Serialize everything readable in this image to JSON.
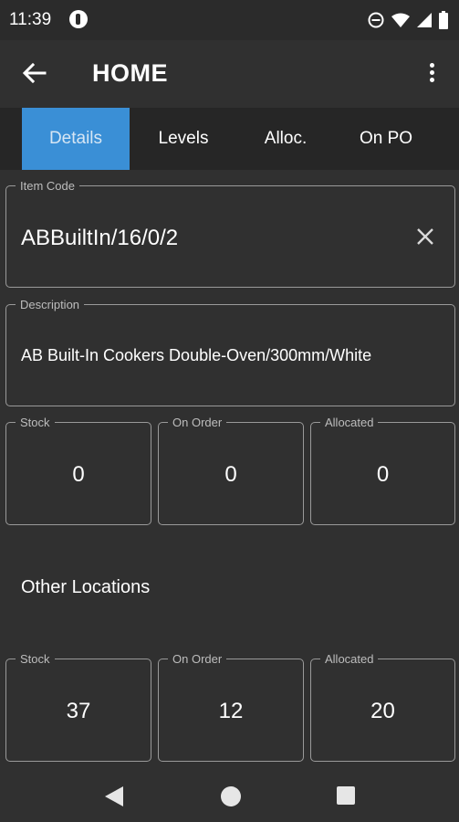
{
  "status": {
    "time": "11:39"
  },
  "app_bar": {
    "title": "HOME"
  },
  "tabs": [
    {
      "label": "Details",
      "active": true
    },
    {
      "label": "Levels",
      "active": false
    },
    {
      "label": "Alloc.",
      "active": false
    },
    {
      "label": "On PO",
      "active": false
    }
  ],
  "item_code": {
    "label": "Item Code",
    "value": "ABBuiltIn/16/0/2"
  },
  "description": {
    "label": "Description",
    "value": "AB Built-In Cookers Double-Oven/300mm/White"
  },
  "current": [
    {
      "label": "Stock",
      "value": "0"
    },
    {
      "label": "On Order",
      "value": "0"
    },
    {
      "label": "Allocated",
      "value": "0"
    }
  ],
  "other_locations": {
    "heading": "Other Locations",
    "boxes": [
      {
        "label": "Stock",
        "value": "37"
      },
      {
        "label": "On Order",
        "value": "12"
      },
      {
        "label": "Allocated",
        "value": "20"
      }
    ]
  },
  "colors": {
    "accent": "#3a8fd6",
    "background": "#303030",
    "tab_bar": "#262626"
  },
  "icons": [
    "back-arrow-icon",
    "overflow-menu-icon",
    "close-icon",
    "nav-back-icon",
    "nav-home-icon",
    "nav-recents-icon"
  ]
}
